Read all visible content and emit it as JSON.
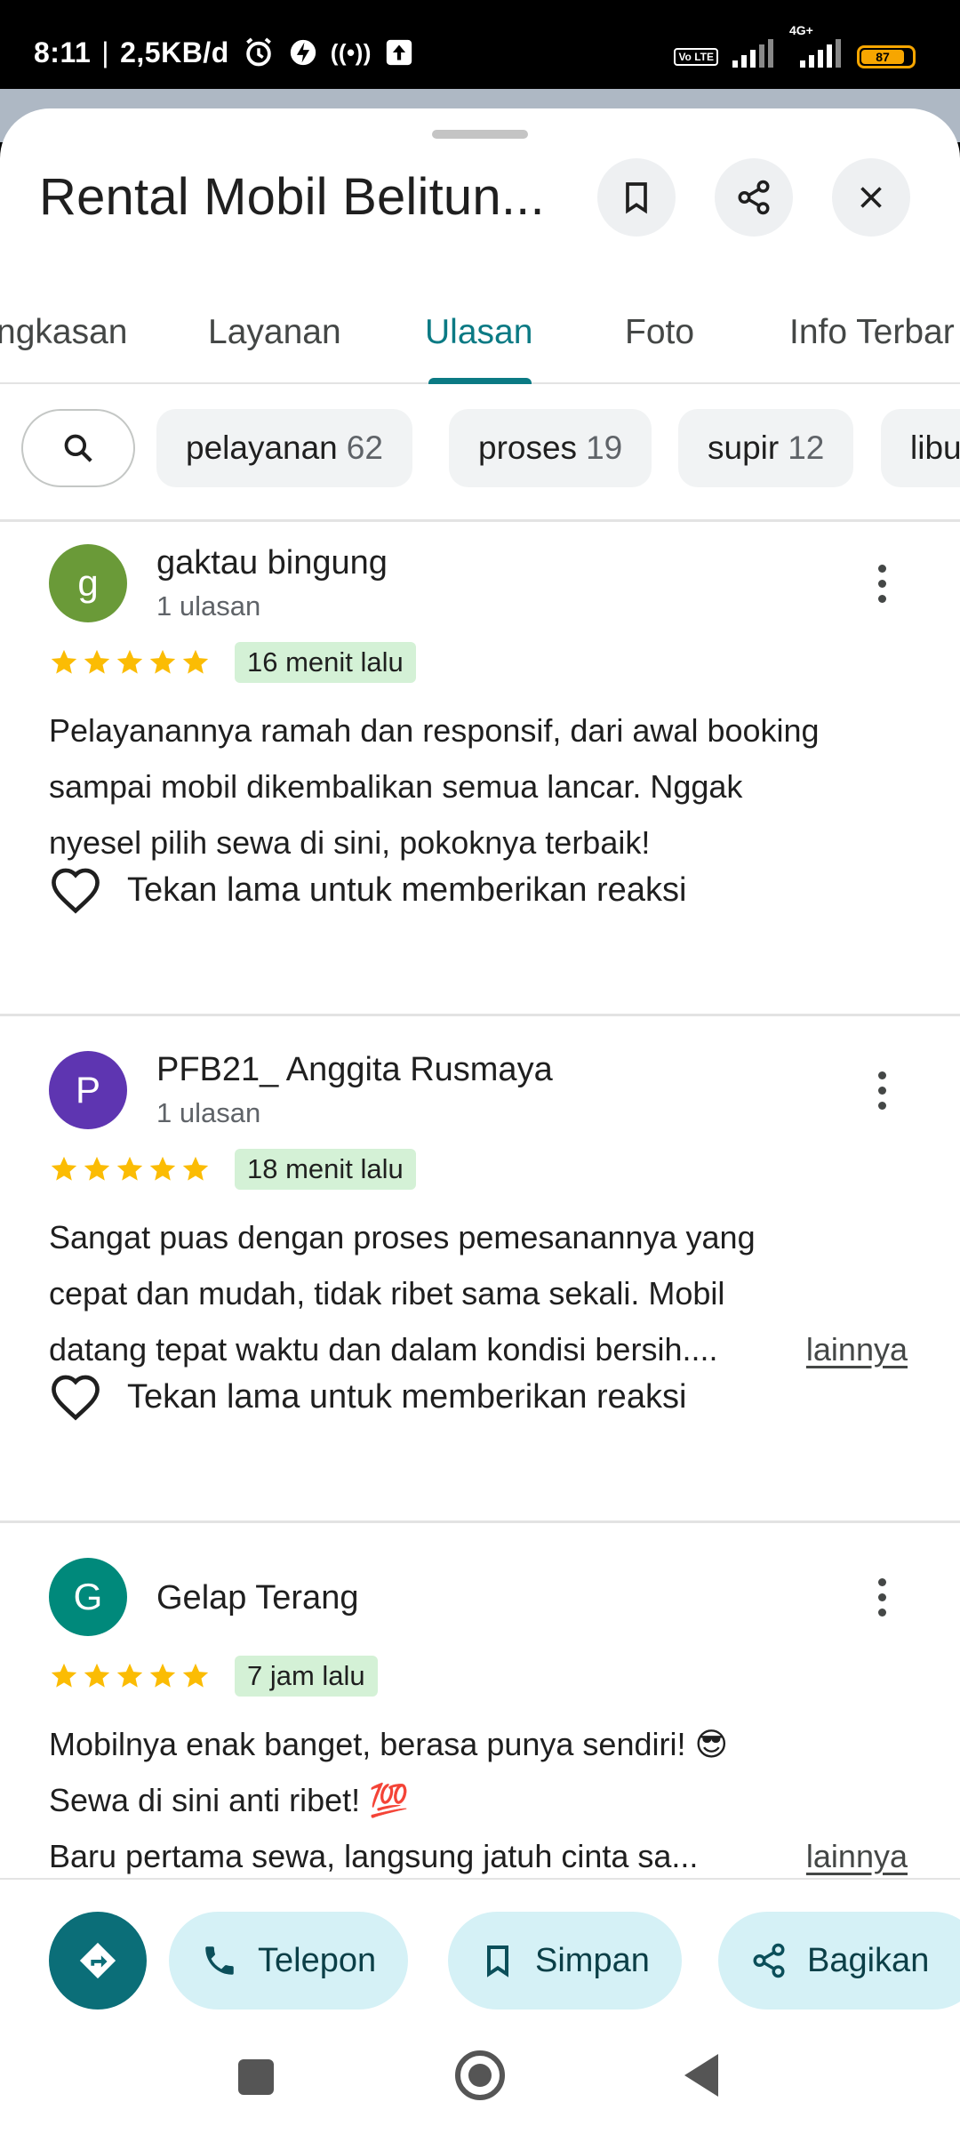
{
  "status_bar": {
    "time": "8:11",
    "separator": "|",
    "speed": "2,5KB/d",
    "signal_label": "4G+",
    "volte": "Vo LTE",
    "battery": "87"
  },
  "header": {
    "title": "Rental Mobil Belitun..."
  },
  "tabs": [
    {
      "label": "ngkasan",
      "active": false
    },
    {
      "label": "Layanan",
      "active": false
    },
    {
      "label": "Ulasan",
      "active": true
    },
    {
      "label": "Foto",
      "active": false
    },
    {
      "label": "Info Terbar",
      "active": false
    }
  ],
  "chips": [
    {
      "label": "pelayanan",
      "count": "62"
    },
    {
      "label": "proses",
      "count": "19"
    },
    {
      "label": "supir",
      "count": "12"
    },
    {
      "label": "libu",
      "count": ""
    }
  ],
  "reviews": [
    {
      "initial": "g",
      "avatar_color": "#6a9a38",
      "name": "gaktau bingung",
      "count": "1 ulasan",
      "time": "16 menit lalu",
      "lines": [
        "Pelayanannya ramah dan responsif, dari awal booking",
        "sampai mobil dikembalikan semua lancar. Nggak",
        "nyesel pilih sewa di sini, pokoknya terbaik!"
      ],
      "more": "",
      "reaction": "Tekan lama untuk memberikan reaksi"
    },
    {
      "initial": "P",
      "avatar_color": "#5e35b1",
      "name": "PFB21_ Anggita Rusmaya",
      "count": "1 ulasan",
      "time": "18 menit lalu",
      "lines": [
        "Sangat puas dengan proses pemesanannya yang",
        "cepat dan mudah, tidak ribet sama sekali. Mobil",
        "datang tepat waktu dan dalam kondisi bersih...."
      ],
      "more": "lainnya",
      "reaction": "Tekan lama untuk memberikan reaksi"
    },
    {
      "initial": "G",
      "avatar_color": "#00897b",
      "name": "Gelap Terang",
      "count": "",
      "time": "7 jam lalu",
      "lines": [
        "Mobilnya enak banget, berasa punya sendiri! 😎",
        "Sewa di sini anti ribet! 💯",
        "Baru pertama sewa, langsung jatuh cinta sa..."
      ],
      "more": "lainnya",
      "reaction": ""
    }
  ],
  "actions": {
    "directions_icon": "directions-icon",
    "call": "Telepon",
    "save": "Simpan",
    "share": "Bagikan"
  },
  "colors": {
    "accent": "#0b7a84",
    "star": "#fbbc04",
    "badge_bg": "#d4f1d6",
    "action_bg": "#d5f1f6"
  }
}
